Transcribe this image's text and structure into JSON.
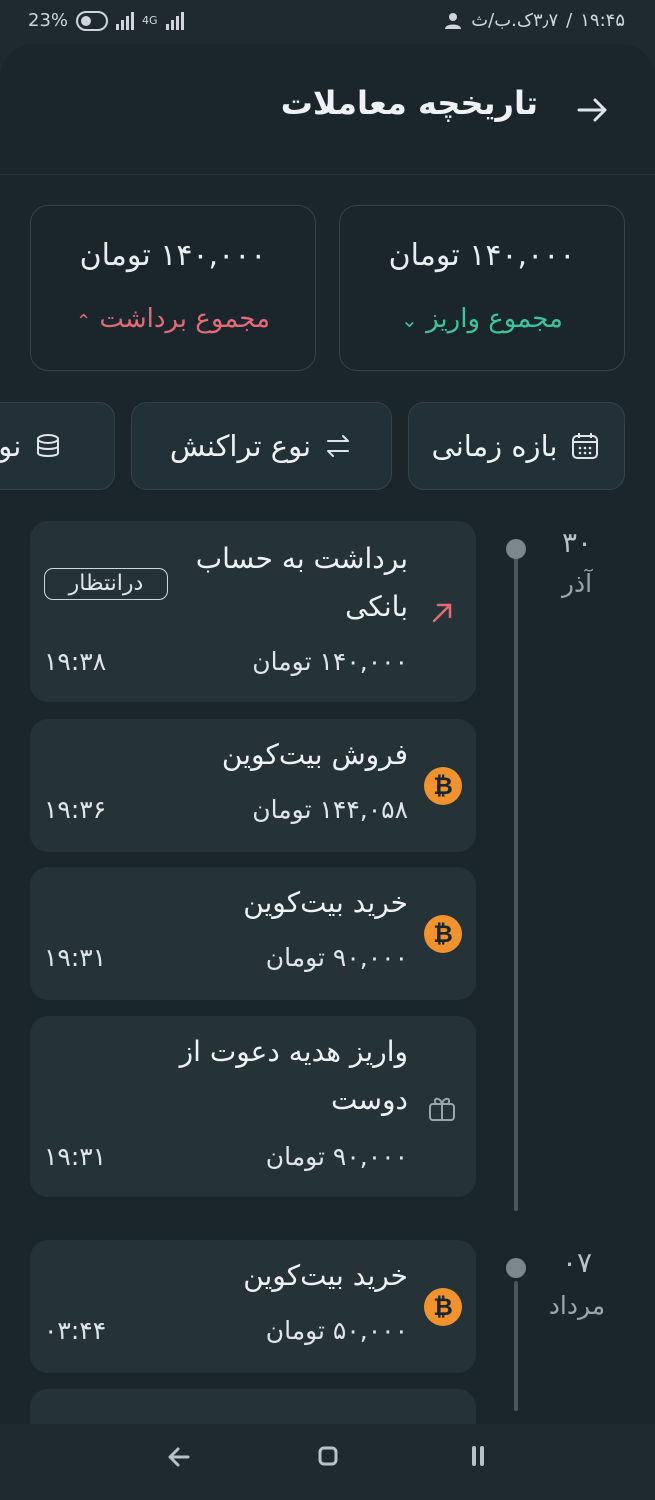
{
  "status_bar": {
    "battery": "23%",
    "network": "4G",
    "time": "۱۹:۴۵",
    "speed": "۳٫۷ک.ب/ث"
  },
  "header": {
    "title": "تاریخچه معاملات",
    "back_icon": "arrow-right-icon"
  },
  "summary": {
    "deposit": {
      "amount": "۱۴۰,۰۰۰ تومان",
      "label": "مجموع واریز",
      "color": "#3fc39a"
    },
    "withdraw": {
      "amount": "۱۴۰,۰۰۰ تومان",
      "label": "مجموع برداشت",
      "color": "#e36a76"
    }
  },
  "filters": [
    {
      "label": "بازه زمانی",
      "icon": "calendar-icon"
    },
    {
      "label": "نوع تراکنش",
      "icon": "swap-icon"
    },
    {
      "label": "نوع",
      "icon": "database-icon"
    }
  ],
  "groups": [
    {
      "day": "۳۰",
      "month": "آذر",
      "transactions": [
        {
          "title": "برداشت به حساب بانکی",
          "amount": "۱۴۰,۰۰۰ تومان",
          "time": "۱۹:۳۸",
          "badge": "درانتظار",
          "icon": "arrow-up-right-icon"
        },
        {
          "title": "فروش بیت‌کوین",
          "amount": "۱۴۴,۰۵۸ تومان",
          "time": "۱۹:۳۶",
          "icon": "bitcoin-icon"
        },
        {
          "title": "خرید بیت‌کوین",
          "amount": "۹۰,۰۰۰ تومان",
          "time": "۱۹:۳۱",
          "icon": "bitcoin-icon"
        },
        {
          "title": "واریز هدیه دعوت از دوست",
          "amount": "۹۰,۰۰۰ تومان",
          "time": "۱۹:۳۱",
          "icon": "gift-icon"
        }
      ]
    },
    {
      "day": "۰۷",
      "month": "مرداد",
      "transactions": [
        {
          "title": "خرید بیت‌کوین",
          "amount": "۵۰,۰۰۰ تومان",
          "time": "۰۳:۴۴",
          "icon": "bitcoin-icon"
        }
      ]
    }
  ]
}
